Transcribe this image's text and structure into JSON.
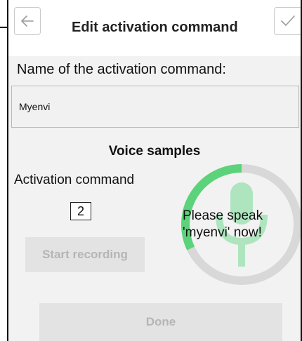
{
  "header": {
    "title": "Edit activation command",
    "back_icon": "arrow-left-icon",
    "confirm_icon": "check-icon"
  },
  "form": {
    "name_label": "Name of the activation command:",
    "name_value": "Myenvi"
  },
  "voice_samples": {
    "title": "Voice samples",
    "activation_label": "Activation command",
    "sample_count": "2",
    "start_button": "Start recording",
    "prompt": "Please speak 'myenvi' now!",
    "recording_progress": 0.32,
    "mic_icon": "microphone-icon"
  },
  "footer": {
    "done_button": "Done"
  },
  "colors": {
    "progress": "#5cd37a",
    "mic": "#aee5be",
    "ring_track": "#d8d8d8",
    "background": "#f2f2f2"
  }
}
